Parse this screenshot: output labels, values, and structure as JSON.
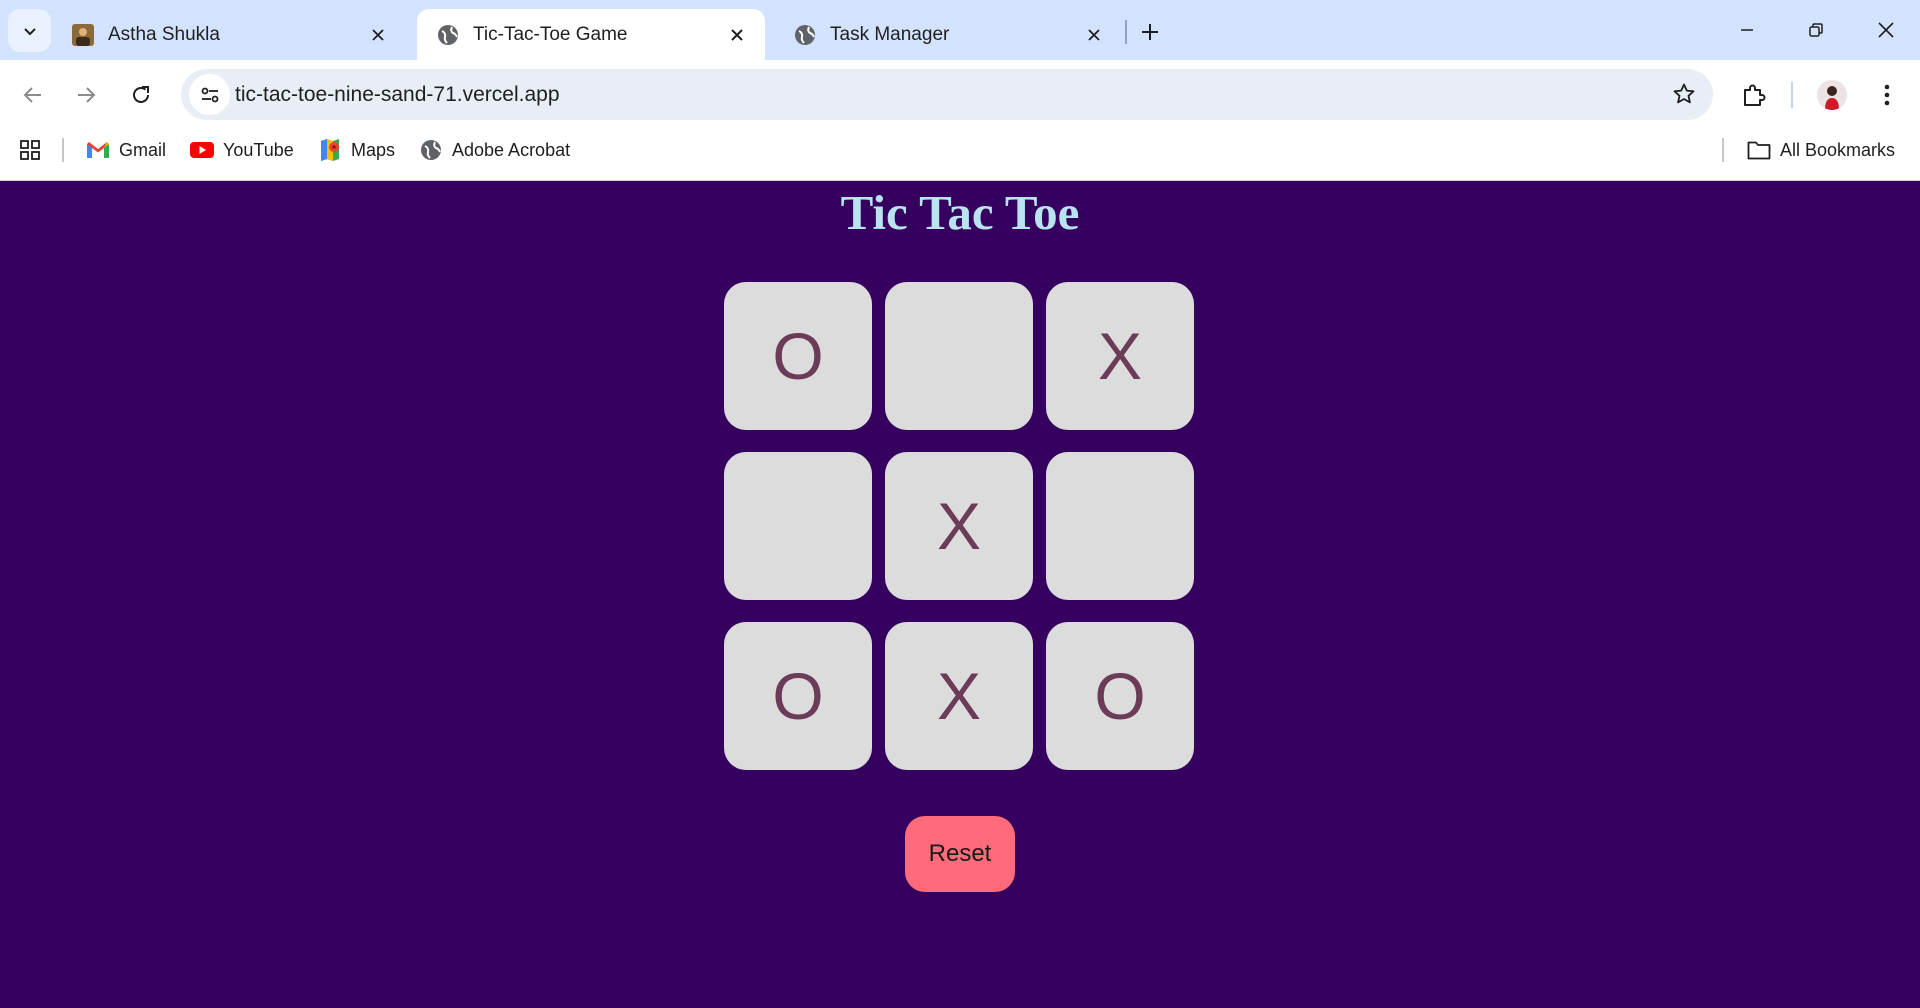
{
  "browser": {
    "tabs": [
      {
        "title": "Astha Shukla",
        "active": false
      },
      {
        "title": "Tic-Tac-Toe Game",
        "active": true
      },
      {
        "title": "Task Manager",
        "active": false
      }
    ],
    "url": "tic-tac-toe-nine-sand-71.vercel.app",
    "bookmarks": [
      {
        "label": "Gmail",
        "icon": "gmail-icon"
      },
      {
        "label": "YouTube",
        "icon": "youtube-icon"
      },
      {
        "label": "Maps",
        "icon": "maps-icon"
      },
      {
        "label": "Adobe Acrobat",
        "icon": "globe-icon"
      }
    ],
    "all_bookmarks_label": "All Bookmarks"
  },
  "game": {
    "title": "Tic Tac Toe",
    "board": [
      "O",
      "",
      "X",
      "",
      "X",
      "",
      "O",
      "X",
      "O"
    ],
    "reset_label": "Reset"
  },
  "colors": {
    "page_background": "#35005e",
    "title": "#b9e4ef",
    "cell_background": "#dcdcdc",
    "mark": "#6b3b58",
    "reset_button": "#ff6b7a"
  }
}
